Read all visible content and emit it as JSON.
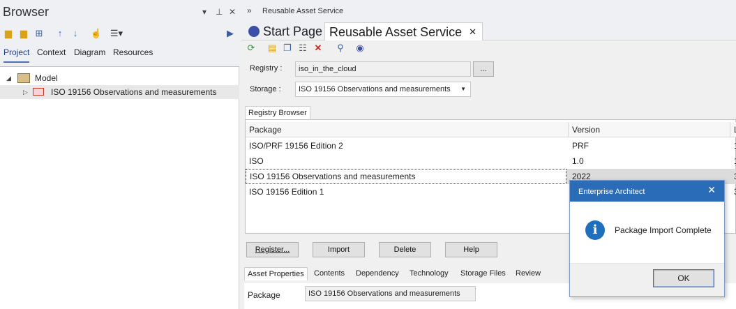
{
  "browser": {
    "title": "Browser",
    "tabs": [
      "Project",
      "Context",
      "Diagram",
      "Resources"
    ],
    "tree": [
      {
        "label": "Model",
        "icon": "model-icon"
      },
      {
        "label": "ISO 19156 Observations and measurements",
        "icon": "package-icon"
      }
    ]
  },
  "main": {
    "breadcrumb": "Reusable Asset Service",
    "tabs": [
      {
        "label": "Start Page"
      },
      {
        "label": "Reusable Asset Service"
      }
    ],
    "registry_label": "Registry :",
    "registry_value": "iso_in_the_cloud",
    "registry_button": "...",
    "storage_label": "Storage :",
    "storage_value": "ISO 19156 Observations and measurements",
    "registry_browser_tab": "Registry Browser",
    "grid": {
      "columns": [
        "Package",
        "Version",
        "L"
      ],
      "rows": [
        {
          "package": "ISO/PRF 19156 Edition 2",
          "version": "PRF",
          "extra": "1"
        },
        {
          "package": "ISO",
          "version": "1.0",
          "extra": "1"
        },
        {
          "package": "ISO 19156 Observations and measurements",
          "version": "2022",
          "extra": "3"
        },
        {
          "package": "ISO 19156 Edition 1",
          "version": "",
          "extra": "3"
        }
      ]
    },
    "buttons": {
      "register": "Register...",
      "import": "Import",
      "delete": "Delete",
      "help": "Help"
    },
    "bottom_tabs": [
      "Asset Properties",
      "Contents",
      "Dependency",
      "Technology",
      "Storage Files",
      "Review"
    ],
    "props": {
      "package_label": "Package",
      "package_value": "ISO 19156 Observations and measurements"
    }
  },
  "dialog": {
    "title": "Enterprise Architect",
    "message": "Package Import Complete",
    "ok": "OK"
  },
  "colors": {
    "dialog_title": "#2b6cb8",
    "info_icon": "#1f6fbf",
    "active_tab_underline": "#4a6fb5"
  }
}
